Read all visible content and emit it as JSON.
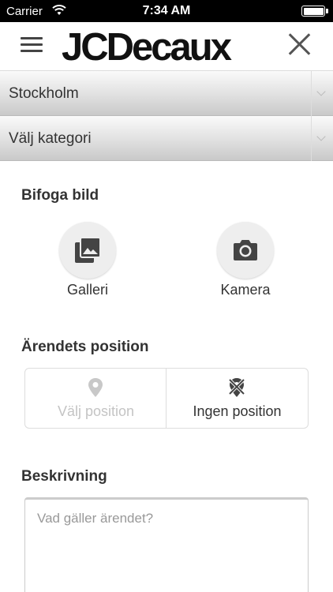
{
  "status_bar": {
    "carrier": "Carrier",
    "time": "7:34 AM"
  },
  "header": {
    "logo": "JCDecaux",
    "menu_icon": "hamburger-menu-icon",
    "close_icon": "close-icon"
  },
  "selects": {
    "city": {
      "value": "Stockholm"
    },
    "category": {
      "value": "Välj kategori"
    }
  },
  "attach": {
    "title": "Bifoga bild",
    "gallery": {
      "label": "Galleri",
      "icon": "gallery-icon"
    },
    "camera": {
      "label": "Kamera",
      "icon": "camera-icon"
    }
  },
  "position": {
    "title": "Ärendets position",
    "choose": {
      "label": "Välj position",
      "icon": "map-pin-icon"
    },
    "none": {
      "label": "Ingen position",
      "icon": "no-location-icon"
    }
  },
  "description": {
    "title": "Beskrivning",
    "placeholder": "Vad gäller ärendet?"
  }
}
